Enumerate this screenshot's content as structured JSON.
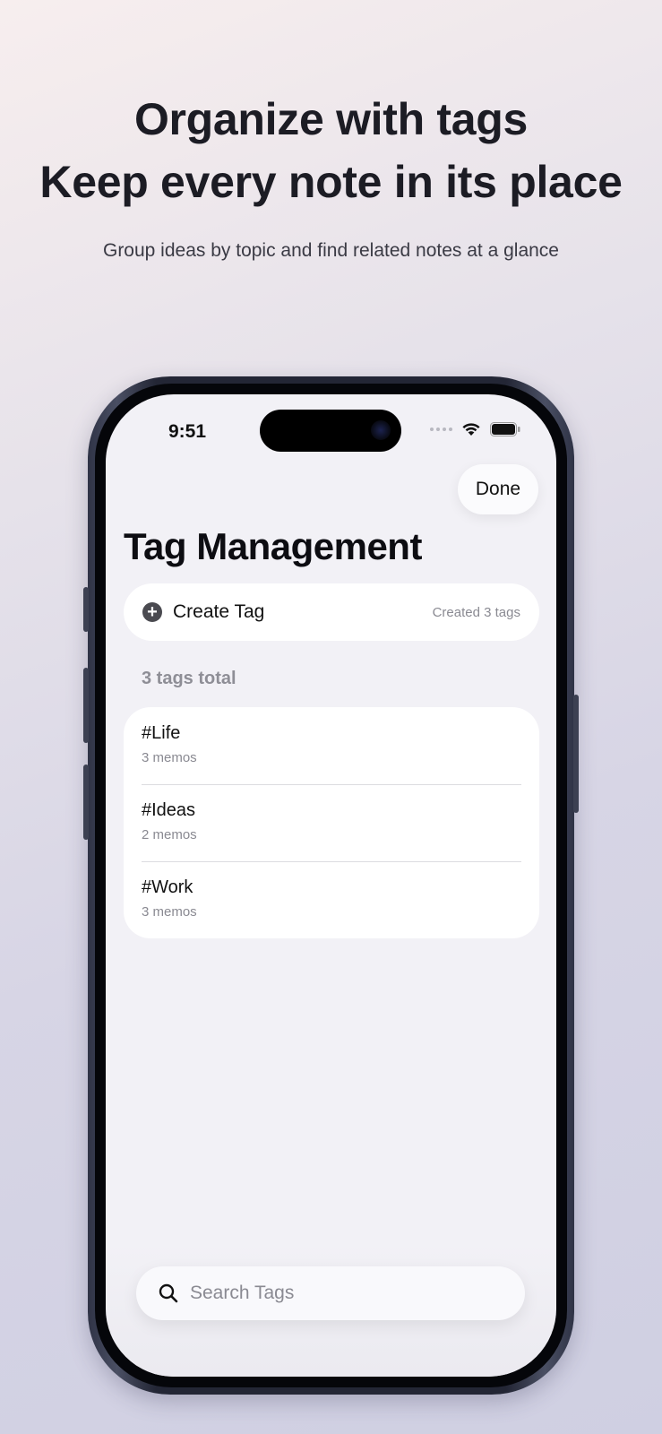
{
  "promo": {
    "headline_line1": "Organize with tags",
    "headline_line2": "Keep every note in its place",
    "subheadline": "Group ideas by topic and find related notes at a glance"
  },
  "status_bar": {
    "time": "9:51",
    "icons": [
      "cellular-signal-icon",
      "wifi-icon",
      "battery-icon"
    ]
  },
  "nav": {
    "done_label": "Done",
    "title": "Tag Management"
  },
  "create_tag": {
    "icon": "plus-circle-icon",
    "label": "Create Tag",
    "count_text": "Created 3 tags"
  },
  "tags_section": {
    "header": "3 tags total",
    "items": [
      {
        "name": "#Life",
        "count": "3 memos"
      },
      {
        "name": "#Ideas",
        "count": "2 memos"
      },
      {
        "name": "#Work",
        "count": "3 memos"
      }
    ]
  },
  "search": {
    "icon": "magnifier-icon",
    "placeholder": "Search Tags",
    "value": ""
  },
  "colors": {
    "screen_background": "#f2f1f6",
    "card_background": "#ffffff",
    "secondary_text": "#8a8a92"
  }
}
